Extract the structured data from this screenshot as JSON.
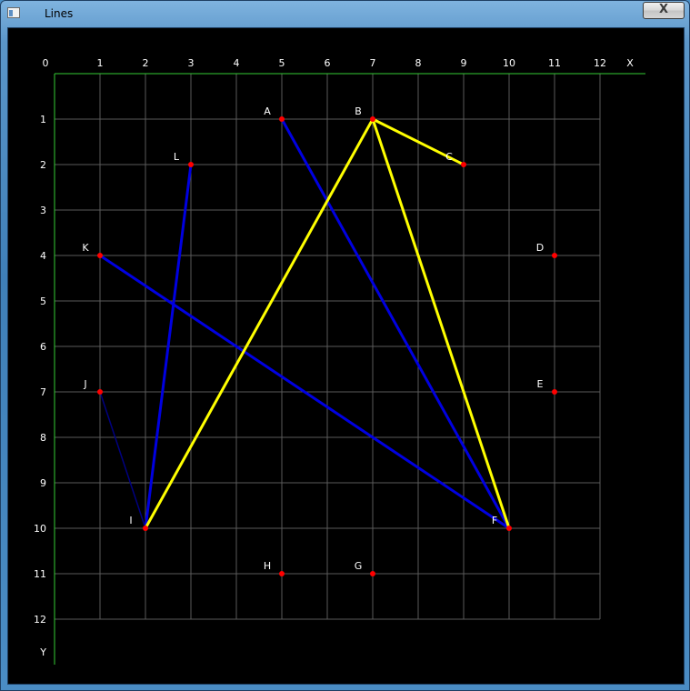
{
  "window": {
    "title": "Lines",
    "close_glyph": "X",
    "icon": "app-window-icon"
  },
  "chart_data": {
    "type": "graph",
    "x_label": "X",
    "y_label": "Y",
    "x_ticks": [
      "0",
      "1",
      "2",
      "3",
      "4",
      "5",
      "6",
      "7",
      "8",
      "9",
      "10",
      "11",
      "12"
    ],
    "y_ticks": [
      "1",
      "2",
      "3",
      "4",
      "5",
      "6",
      "7",
      "8",
      "9",
      "10",
      "11",
      "12"
    ],
    "grid": true,
    "points": [
      {
        "name": "A",
        "x": 5,
        "y": 1
      },
      {
        "name": "B",
        "x": 7,
        "y": 1
      },
      {
        "name": "C",
        "x": 9,
        "y": 2
      },
      {
        "name": "D",
        "x": 11,
        "y": 4
      },
      {
        "name": "E",
        "x": 11,
        "y": 7
      },
      {
        "name": "F",
        "x": 10,
        "y": 10
      },
      {
        "name": "G",
        "x": 7,
        "y": 11
      },
      {
        "name": "H",
        "x": 5,
        "y": 11
      },
      {
        "name": "I",
        "x": 2,
        "y": 10
      },
      {
        "name": "J",
        "x": 1,
        "y": 7
      },
      {
        "name": "K",
        "x": 1,
        "y": 4
      },
      {
        "name": "L",
        "x": 3,
        "y": 2
      }
    ],
    "segments": [
      {
        "from": "A",
        "to": "F",
        "color": "#0000e0",
        "style": "thick"
      },
      {
        "from": "K",
        "to": "F",
        "color": "#0000e0",
        "style": "thick"
      },
      {
        "from": "L",
        "to": "I",
        "color": "#0000e0",
        "style": "thick"
      },
      {
        "from": "J",
        "to": "I",
        "color": "#000080",
        "style": "thin"
      },
      {
        "from": "B",
        "to": "C",
        "color": "#ffff00",
        "style": "thick"
      },
      {
        "from": "B",
        "to": "I",
        "color": "#ffff00",
        "style": "thick"
      },
      {
        "from": "B",
        "to": "F",
        "color": "#ffff00",
        "style": "thick"
      }
    ],
    "colors": {
      "grid": "#5a5a5a",
      "axis": "#33cc33",
      "point": "#ff0000",
      "label": "#ffffff"
    }
  }
}
